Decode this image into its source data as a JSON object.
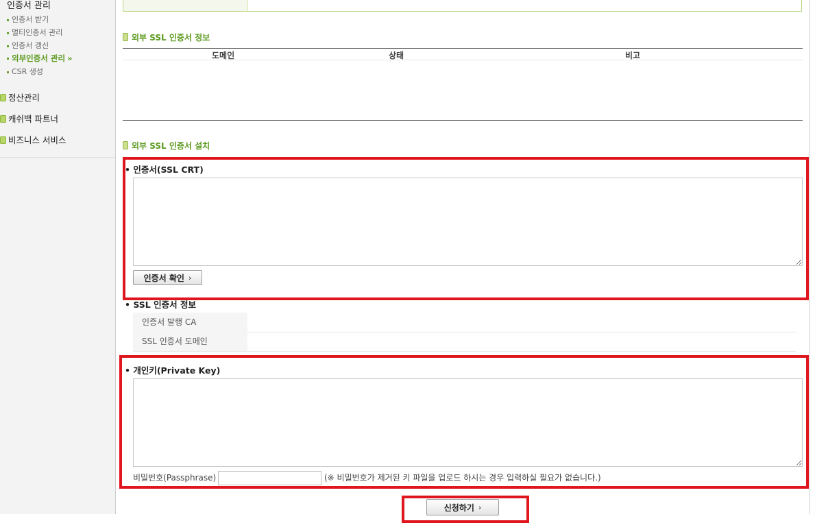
{
  "sidebar": {
    "group_title": "인증서 관리",
    "sub_items": [
      {
        "label": "인증서 받기"
      },
      {
        "label": "멀티인증서 관리"
      },
      {
        "label": "인증서 갱신"
      },
      {
        "label": "외부인증서 관리"
      },
      {
        "label": "CSR 생성"
      }
    ],
    "active_arrow": "»",
    "main_items": [
      {
        "label": "정산관리"
      },
      {
        "label": "캐쉬백 파트너"
      },
      {
        "label": "비즈니스 서비스"
      }
    ]
  },
  "ssl_info": {
    "title": "외부 SSL 인증서 정보",
    "columns": [
      "도메인",
      "상태",
      "비고"
    ],
    "rows": []
  },
  "ssl_install": {
    "title": "외부 SSL 인증서 설치",
    "crt_label": "• 인증서(SSL CRT)",
    "crt_value": "",
    "verify_button": "인증서 확인",
    "chevron": "›",
    "cert_info_label": "• SSL 인증서 정보",
    "cert_info_rows": [
      {
        "key": "인증서 발행 CA",
        "value": ""
      },
      {
        "key": "SSL 인증서 도메인",
        "value": ""
      }
    ],
    "key_label": "• 개인키(Private Key)",
    "key_value": "",
    "passphrase_label": "비밀번호(Passphrase)",
    "passphrase_value": "",
    "passphrase_note": "(※ 비밀번호가 제거된 키 파일을 업로드 하시는 경우 입력하실 필요가 없습니다.)",
    "submit_button": "신청하기"
  },
  "colors": {
    "accent_green": "#5c9a1f",
    "highlight_red": "#e0161f"
  }
}
